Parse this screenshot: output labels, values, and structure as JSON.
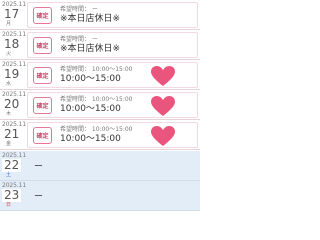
{
  "rows": [
    {
      "ym": "2025.11",
      "day": "17",
      "dow": "月",
      "badge": "確定",
      "label": "希望時間： ー",
      "main": "※本日店休日※",
      "heart": false
    },
    {
      "ym": "2025.11",
      "day": "18",
      "dow": "火",
      "badge": "確定",
      "label": "希望時間： ー",
      "main": "※本日店休日※",
      "heart": false
    },
    {
      "ym": "2025.11",
      "day": "19",
      "dow": "水",
      "badge": "確定",
      "label": "希望時間： 10:00〜15:00",
      "main": "10:00〜15:00",
      "heart": true
    },
    {
      "ym": "2025.11",
      "day": "20",
      "dow": "木",
      "badge": "確定",
      "label": "希望時間： 10:00〜15:00",
      "main": "10:00〜15:00",
      "heart": true
    },
    {
      "ym": "2025.11",
      "day": "21",
      "dow": "金",
      "badge": "確定",
      "label": "希望時間： 10:00〜15:00",
      "main": "10:00〜15:00",
      "heart": true
    },
    {
      "ym": "2025.11",
      "day": "22",
      "dow": "土",
      "dash": "ー"
    },
    {
      "ym": "2025.11",
      "day": "23",
      "dow": "日",
      "dash": "ー"
    }
  ],
  "colors": {
    "heart": "#e9557d",
    "badge_border": "#e07a96",
    "blank_row_bg": "#e3edf8",
    "saturday": "#3e6fd6",
    "sunday": "#e04a4a"
  },
  "icons": {
    "heart": "heart-icon"
  }
}
